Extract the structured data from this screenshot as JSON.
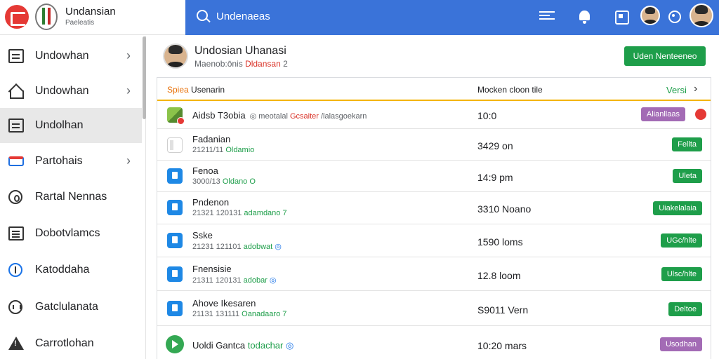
{
  "app": {
    "title": "Undansian",
    "subtitle": "Paeleatis"
  },
  "topbar": {
    "search_text": "Undenaeas"
  },
  "sidebar": {
    "items": [
      {
        "label": "Undowhan",
        "icon": "document-icon",
        "chevron": "›",
        "active": false
      },
      {
        "label": "Undowhan",
        "icon": "home-icon",
        "chevron": "›",
        "active": false
      },
      {
        "label": "Undolhan",
        "icon": "document-icon",
        "active": true
      },
      {
        "label": "Partohais",
        "icon": "card-icon",
        "chevron": "›",
        "active": false
      },
      {
        "label": "Rartal Nennas",
        "icon": "circle-icon",
        "active": false
      },
      {
        "label": "Dobotvlamcs",
        "icon": "list-icon",
        "active": false
      },
      {
        "label": "Katoddaha",
        "icon": "info-icon",
        "active": false
      },
      {
        "label": "Gatclulanata",
        "icon": "calendar-icon",
        "active": false
      },
      {
        "label": "Carrotlohan",
        "icon": "warning-icon",
        "active": false
      }
    ]
  },
  "main": {
    "title": "Undosian Uhanasi",
    "subtitle_prefix": "Maenob:ōnis ",
    "subtitle_accent": "Dldansan",
    "subtitle_suffix": " 2",
    "primary_button": "Uden Nenteeneo"
  },
  "table": {
    "header": {
      "name_first": "Spiea",
      "name_rest": " Usenarin",
      "size": "Mocken cloon tile",
      "version": "Versi",
      "chevron": "›"
    },
    "rows": [
      {
        "name": "Aidsb T3obia",
        "inline_meta_prefix": "◎ meotalal ",
        "inline_meta_accent": "Gcsaiter",
        "inline_meta_suffix": " /lalasgoekarn",
        "size": "10:0",
        "badge": "Alianllaas",
        "badge_color": "purple",
        "status_dot": true,
        "icon": "image-file-icon"
      },
      {
        "name": "Fadanian",
        "meta_prefix": "21211/11 ",
        "meta_accent": "Oldamio",
        "size": "3429 on",
        "badge": "Fellta",
        "badge_color": "green",
        "icon": "blank-file-icon"
      },
      {
        "name": "Fenoa",
        "meta_prefix": "3000/13 ",
        "meta_accent": "Oldano",
        "meta_suffix": " O",
        "size": "14:9 pm",
        "badge": "Uleta",
        "badge_color": "green",
        "icon": "document-icon"
      },
      {
        "name": "Pndenon",
        "meta_prefix": "21321 120131 ",
        "meta_accent": "adamdano 7",
        "size": "3310 Noano",
        "badge": "Uiakelalaia",
        "badge_color": "green",
        "icon": "edit-document-icon"
      },
      {
        "name": "Sske",
        "meta_prefix": "21231 121101 ",
        "meta_accent": "adobwat",
        "meta_suffix_blue": " ◎",
        "size": "1590 loms",
        "badge": "UGc/hlte",
        "badge_color": "green",
        "icon": "document-icon"
      },
      {
        "name": "Fnensisie",
        "meta_prefix": "21311 120131 ",
        "meta_accent": "adobar",
        "meta_suffix_blue": " ◎",
        "size": "12.8 loom",
        "badge": "Ulsc/hlte",
        "badge_color": "green",
        "icon": "document-icon"
      },
      {
        "name": "Ahove Ikesaren",
        "meta_prefix": "21131 131111 ",
        "meta_accent": "Oanadaaro 7",
        "size": "S9011 Vern",
        "badge": "Deltoe",
        "badge_color": "green",
        "icon": "document-icon"
      },
      {
        "name": "Uoldi Gantca ",
        "name_accent": "todachar",
        "name_accent_blue": " ◎",
        "size": "10:20 mars",
        "badge": "Usodhan",
        "badge_color": "purple",
        "icon": "play-circle-icon"
      }
    ]
  },
  "colors": {
    "topbar": "#3a73d9",
    "primary": "#1e9e4a",
    "purple_badge": "#a36bb5",
    "header_underline": "#f4b400"
  }
}
